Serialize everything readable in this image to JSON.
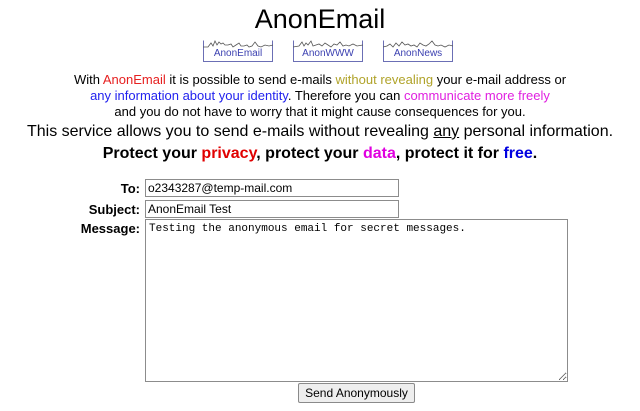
{
  "app": {
    "title": "AnonEmail"
  },
  "nav": [
    {
      "label": "AnonEmail"
    },
    {
      "label": "AnonWWW"
    },
    {
      "label": "AnonNews"
    }
  ],
  "intro": {
    "p1": "With ",
    "brand": "AnonEmail",
    "p2": " it is possible to send e-mails ",
    "highlight1": "without revealing",
    "p3": " your e-mail address or",
    "highlight2": "any information about your identity",
    "p4": ". Therefore you can ",
    "highlight3": "communicate more freely",
    "p5": "and you do not have to worry that it might cause consequences for you."
  },
  "statement": {
    "prefix": "This service allows you to send e-mails without revealing ",
    "emphasis": "any",
    "suffix": " personal information."
  },
  "slogan": {
    "part1": "Protect your ",
    "word1": "privacy",
    "part2": ", protect your ",
    "word2": "data",
    "part3": ", protect it for ",
    "word3": "free",
    "part4": "."
  },
  "form": {
    "to_label": "To:",
    "to_value": "o2343287@temp-mail.com",
    "subject_label": "Subject:",
    "subject_value": "AnonEmail Test",
    "message_label": "Message:",
    "message_value": "Testing the anonymous email for secret messages.",
    "submit_label": "Send Anonymously"
  },
  "colors": {
    "brand_red": "#e62020",
    "olive": "#b0a32a",
    "blue": "#2222ee",
    "magenta": "#e020e0",
    "nav_border": "#6b6fb5"
  }
}
